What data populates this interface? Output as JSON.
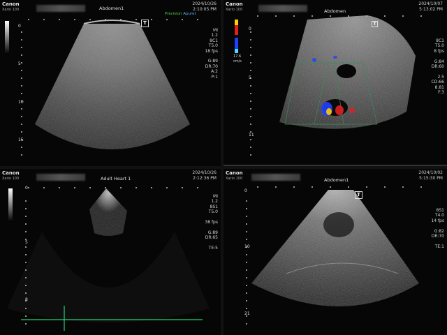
{
  "panels": [
    {
      "brand": "Canon",
      "model": "Xario 100",
      "exam": "Abdomen1",
      "date": "2024/10/26",
      "time": "2:10:05 PM",
      "tab_left": "Precision",
      "tab_right": "ApureI",
      "params": [
        "MI",
        "1.2",
        "8C1",
        "T5.0",
        "18 fps",
        "",
        "G:89",
        "DR:70",
        "A:2",
        "P:1"
      ],
      "depth_marks": [
        "0",
        "5",
        "10",
        "15"
      ]
    },
    {
      "brand": "Canon",
      "model": "Xario 100",
      "exam": "Abdomen",
      "date": "2024/10/07",
      "time": "5:13:02 PM",
      "params": [
        "8C1",
        "T5.0",
        "8 fps",
        "",
        "G:84",
        "DR:60",
        "",
        "2.5",
        "CD:66",
        "8.81",
        "F:3"
      ],
      "scale_top": "17.6",
      "scale_unit": "cm/s",
      "depth_marks": [
        "0",
        "5",
        "11"
      ]
    },
    {
      "brand": "Canon",
      "model": "Xario 100",
      "exam": "Adult Heart 1",
      "date": "2024/10/26",
      "time": "2:12:36 PM",
      "params": [
        "MI",
        "1.2",
        "8S1",
        "T5.0",
        "",
        "38 fps",
        "",
        "G:89",
        "DR:65",
        "",
        "TE:5"
      ],
      "depth_marks": [
        "0",
        "5",
        "8"
      ]
    },
    {
      "brand": "Canon",
      "model": "Xario 100",
      "exam": "Abdomen1",
      "date": "2024/10/02",
      "time": "5:15:30 PM",
      "params": [
        "8S1",
        "T4.0",
        "14 fps",
        "",
        "G:82",
        "DR:70",
        "",
        "TE:1"
      ],
      "depth_marks": [
        "0",
        "10",
        "21"
      ]
    }
  ],
  "colors": {
    "green_line": "#27d07a",
    "doppler_red": "#e02020",
    "doppler_blue": "#2040ff"
  }
}
